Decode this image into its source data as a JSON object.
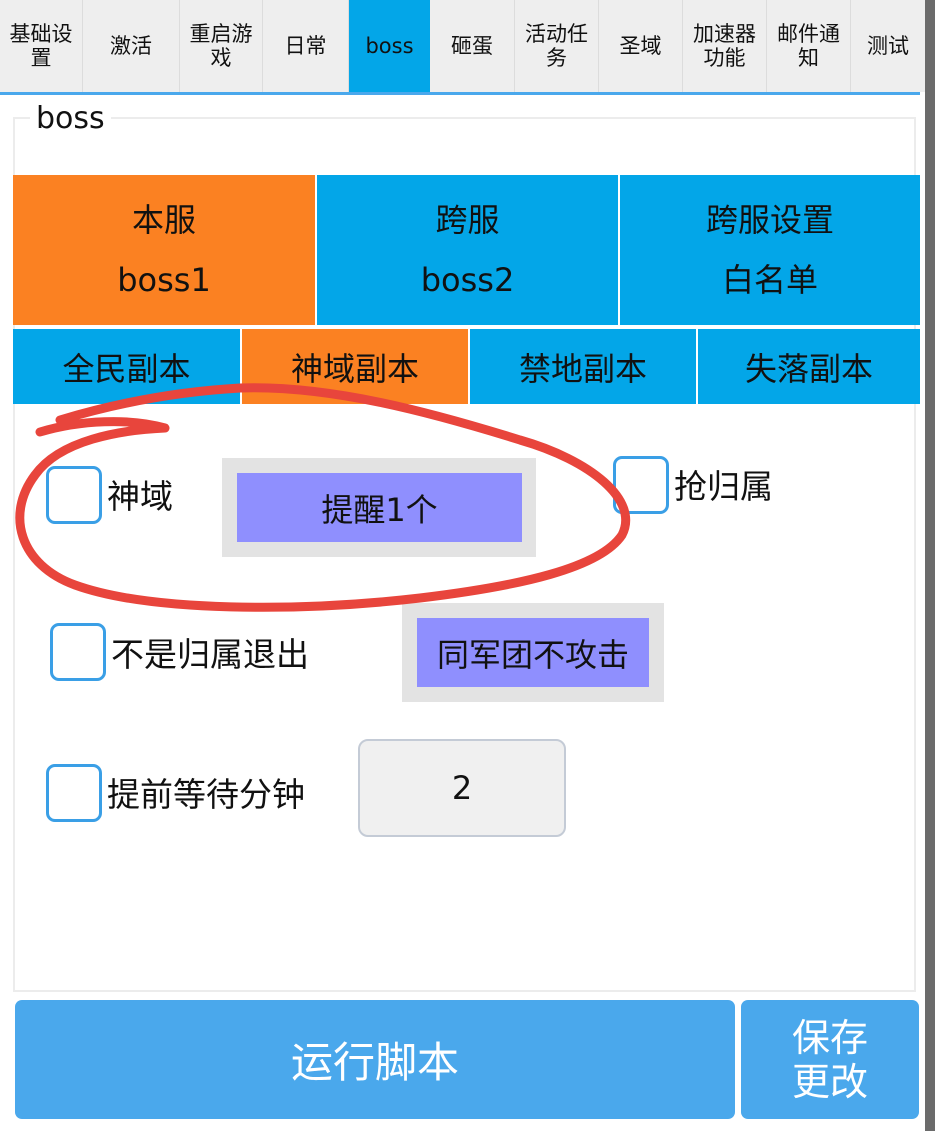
{
  "tabs": [
    {
      "label": "基础设\n置"
    },
    {
      "label": "激活"
    },
    {
      "label": "重启游\n戏"
    },
    {
      "label": "日常"
    },
    {
      "label": "boss",
      "active": true
    },
    {
      "label": "砸蛋"
    },
    {
      "label": "活动任\n务"
    },
    {
      "label": "圣域"
    },
    {
      "label": "加速器\n功能"
    },
    {
      "label": "邮件通\n知"
    },
    {
      "label": "测试"
    }
  ],
  "group_title": "boss",
  "server_buttons": [
    {
      "line1": "本服",
      "line2": "boss1",
      "selected": true
    },
    {
      "line1": "跨服",
      "line2": "boss2",
      "selected": false
    },
    {
      "line1": "跨服设置",
      "line2": "白名单",
      "selected": false
    }
  ],
  "dungeon_tabs": [
    {
      "label": "全民副本",
      "selected": false
    },
    {
      "label": "神域副本",
      "selected": true
    },
    {
      "label": "禁地副本",
      "selected": false
    },
    {
      "label": "失落副本",
      "selected": false
    }
  ],
  "options": {
    "shenyu": {
      "label": "神域",
      "checked": false,
      "button": "提醒1个"
    },
    "qiang_guishu": {
      "label": "抢归属",
      "checked": false
    },
    "not_owner_exit": {
      "label": "不是归属退出",
      "checked": false,
      "button": "同军团不攻击"
    },
    "wait_minutes": {
      "label": "提前等待分钟",
      "checked": false,
      "value": "2"
    }
  },
  "footer": {
    "run_label": "运行脚本",
    "save_label": "保存\n更改"
  },
  "colors": {
    "tab_active": "#03a6e8",
    "orange": "#fb8122",
    "blue": "#03a6e8",
    "purple": "#8f8ffe",
    "footer_blue": "#4aa8ec",
    "annotation_red": "#e8453c"
  }
}
